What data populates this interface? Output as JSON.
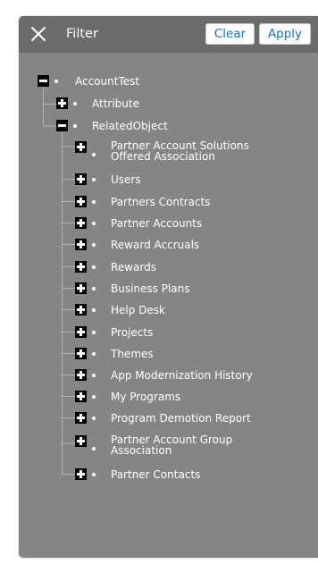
{
  "header": {
    "title": "Filter",
    "clear_label": "Clear",
    "apply_label": "Apply",
    "close_icon": "close-icon"
  },
  "tree": {
    "root": {
      "label": "AccountTest",
      "state": "expanded"
    },
    "attribute": {
      "label": "Attribute",
      "state": "collapsed"
    },
    "related_object": {
      "label": "RelatedObject",
      "state": "expanded"
    },
    "children": [
      {
        "label": "Partner Account Solutions Offered Association",
        "line1": "Partner Account Solutions",
        "line2": "Offered Association",
        "state": "collapsed"
      },
      {
        "label": "Users",
        "state": "collapsed"
      },
      {
        "label": "Partners Contracts",
        "state": "collapsed"
      },
      {
        "label": "Partner Accounts",
        "state": "collapsed"
      },
      {
        "label": "Reward Accruals",
        "state": "collapsed"
      },
      {
        "label": "Rewards",
        "state": "collapsed"
      },
      {
        "label": "Business Plans",
        "state": "collapsed"
      },
      {
        "label": "Help Desk",
        "state": "collapsed"
      },
      {
        "label": "Projects",
        "state": "collapsed"
      },
      {
        "label": "Themes",
        "state": "collapsed"
      },
      {
        "label": "App Modernization History",
        "state": "collapsed"
      },
      {
        "label": "My Programs",
        "state": "collapsed"
      },
      {
        "label": "Program Demotion Report",
        "state": "collapsed"
      },
      {
        "label": "Partner Account Group Association",
        "line1": "Partner Account Group",
        "line2": "Association",
        "state": "collapsed"
      },
      {
        "label": "Partner Contacts",
        "state": "collapsed"
      }
    ]
  },
  "colors": {
    "panel_bg": "#858585",
    "header_bg": "#6b6b6b",
    "button_text": "#1570c9",
    "tree_line": "#b3b3b3"
  }
}
